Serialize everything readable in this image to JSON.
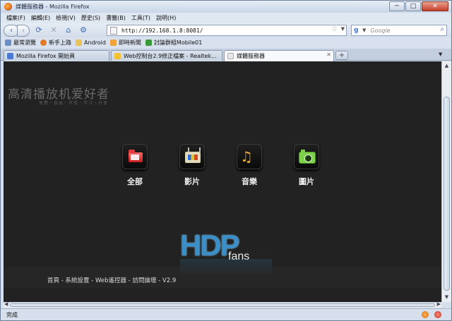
{
  "window": {
    "title": "媒體服務器 - Mozilla Firefox",
    "controls": [
      "─",
      "□",
      "✕"
    ]
  },
  "menu": [
    "檔案(F)",
    "編輯(E)",
    "檢視(V)",
    "歷史(S)",
    "書籤(B)",
    "工具(T)",
    "說明(H)"
  ],
  "nav": {
    "back": "‹",
    "forward": "›",
    "url": "http://192.168.1.8:8081/",
    "search_placeholder": "Google",
    "search_engine": "g"
  },
  "bookmarks": [
    {
      "label": "最常瀏覽",
      "icon": "bookmark-icon",
      "color": "#6d8fc7"
    },
    {
      "label": "新手上路",
      "icon": "firefox-icon",
      "color": "#e07a25"
    },
    {
      "label": "Android",
      "icon": "folder-icon",
      "color": "#e9c25a"
    },
    {
      "label": "即時新聞",
      "icon": "rss-icon",
      "color": "#f0a33a"
    },
    {
      "label": "討論群組Mobile01",
      "icon": "mobile01-icon",
      "color": "#3a9a3a"
    }
  ],
  "tabs": [
    {
      "label": "Mozilla Firefox 開始頁",
      "icon": "google-icon",
      "color": "#4a7bd0"
    },
    {
      "label": "Web控制台2.9修正檔案 - Realtek...",
      "icon": "forum-icon",
      "color": "#f2c230"
    },
    {
      "label": "媒體服務器",
      "icon": "page-icon",
      "color": "#e8e8e8"
    }
  ],
  "page": {
    "brand": "高清播放机爱好者",
    "tagline": "免费・自由・开放・学习・分享",
    "tiles": [
      {
        "label": "全部",
        "icon": "folder-icon"
      },
      {
        "label": "影片",
        "icon": "tv-icon"
      },
      {
        "label": "音樂",
        "icon": "music-icon"
      },
      {
        "label": "圖片",
        "icon": "camera-icon"
      }
    ],
    "logo_main": "HDP",
    "logo_sub": "fans",
    "footer_nav": "首頁 - 系統設置 - Web遙控器 - 訪問論壇 - V2.9"
  },
  "status": {
    "text": "完成"
  }
}
